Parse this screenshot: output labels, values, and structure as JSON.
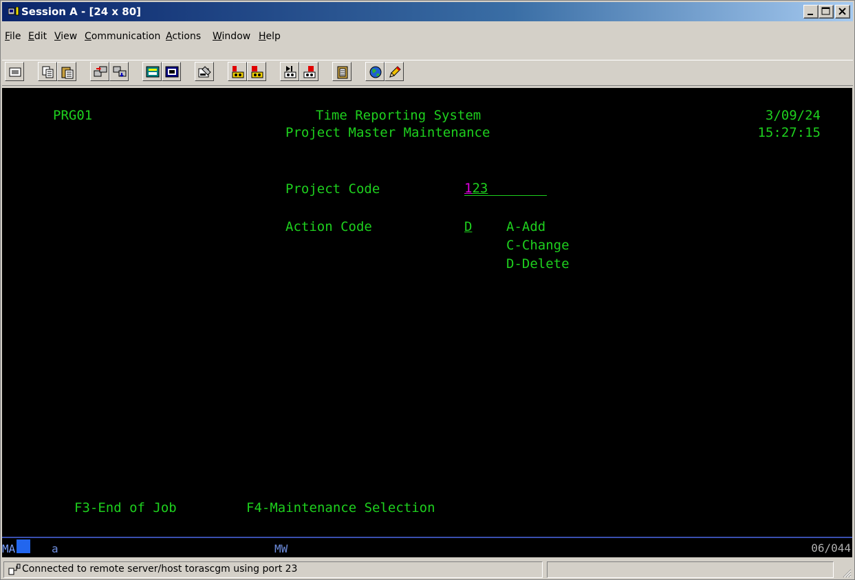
{
  "window": {
    "title": "Session A - [24 x 80]"
  },
  "menu": [
    {
      "label": "File"
    },
    {
      "label": "Edit"
    },
    {
      "label": "View"
    },
    {
      "label": "Communication"
    },
    {
      "label": "Actions"
    },
    {
      "label": "Window"
    },
    {
      "label": "Help"
    }
  ],
  "toolbar_icons": [
    "display-setup-icon",
    "copy-icon",
    "paste-icon",
    "send-icon",
    "receive-icon",
    "display-keypad-icon",
    "display-window-icon",
    "macro-icon",
    "record-macro-icon",
    "stop-macro-icon",
    "play-macro-icon",
    "run-macro-icon",
    "clipboard-icon",
    "web-globe-icon",
    "pencil-icon"
  ],
  "screen": {
    "program_id": "PRG01",
    "system_title": "Time Reporting System",
    "screen_title": "Project Master Maintenance",
    "date": "3/09/24",
    "time": "15:27:15",
    "project_code_label": "Project Code",
    "project_code_cursor_char": "1",
    "project_code_rest": "23",
    "action_code_label": "Action Code",
    "action_code_value": "D",
    "action_options": [
      "A-Add",
      "C-Change",
      "D-Delete"
    ],
    "fkey_f3": "F3-End of Job",
    "fkey_f4": "F4-Maintenance Selection"
  },
  "oia": {
    "ma": "MA",
    "mode": "a",
    "mw": "MW",
    "cursor_position": "06/044"
  },
  "status": {
    "connection_text": "Connected to remote server/host torascgm using port 23"
  },
  "colors": {
    "terminal_bg": "#000000",
    "terminal_green": "#1ed01e",
    "cursor_magenta": "#e000e0",
    "oia_blue": "#4f7bdd"
  }
}
